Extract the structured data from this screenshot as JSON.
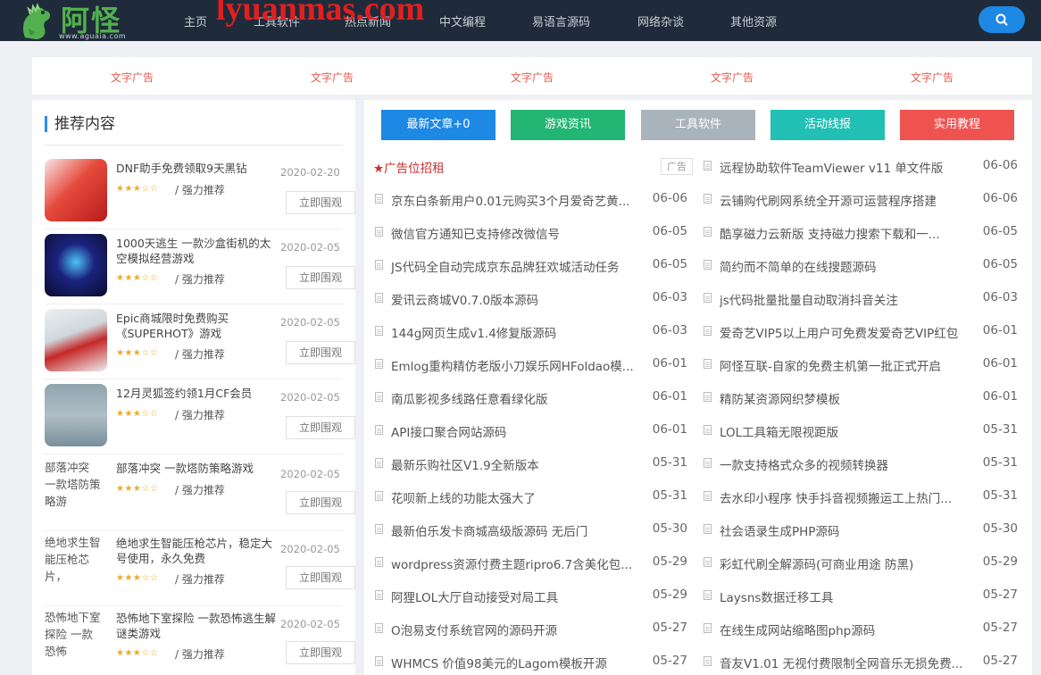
{
  "header": {
    "logo_text": "阿怪",
    "logo_url": "www.aguaia.com",
    "watermark": "lyuanmas.com",
    "nav": [
      "主页",
      "工具软件",
      "热点新闻",
      "中文编程",
      "易语言源码",
      "网络杂谈",
      "其他资源"
    ]
  },
  "ads": [
    "文字广告",
    "文字广告",
    "文字广告",
    "文字广告",
    "文字广告"
  ],
  "sidebar": {
    "title": "推荐内容",
    "items": [
      {
        "title": "DNF助手免费领取9天黑钻",
        "label": "/ 强力推荐",
        "date": "2020-02-20",
        "button": "立即围观",
        "stars": "★★★☆☆",
        "thumb_alt": ""
      },
      {
        "title": "1000天逃生 一款沙盒街机的太空模拟经营游戏",
        "label": "/ 强力推荐",
        "date": "2020-02-05",
        "button": "立即围观",
        "stars": "★★★☆☆",
        "thumb_alt": ""
      },
      {
        "title": "Epic商城限时免费购买《SUPERHOT》游戏",
        "label": "/ 强力推荐",
        "date": "2020-02-05",
        "button": "立即围观",
        "stars": "★★★☆☆",
        "thumb_alt": ""
      },
      {
        "title": "12月灵狐签约领1月CF会员",
        "label": "/ 强力推荐",
        "date": "2020-02-05",
        "button": "立即围观",
        "stars": "★★★☆☆",
        "thumb_alt": ""
      },
      {
        "title": "部落冲突 一款塔防策略游戏",
        "label": "/ 强力推荐",
        "date": "2020-02-05",
        "button": "立即围观",
        "stars": "★★★☆☆",
        "thumb_alt": "部落冲突 一款塔防策略游"
      },
      {
        "title": "绝地求生智能压枪芯片，稳定大号使用，永久免费",
        "label": "/ 强力推荐",
        "date": "2020-02-05",
        "button": "立即围观",
        "stars": "★★★☆☆",
        "thumb_alt": "绝地求生智能压枪芯片，"
      },
      {
        "title": "恐怖地下室探险 一款恐怖逃生解谜类游戏",
        "label": "/ 强力推荐",
        "date": "2020-02-05",
        "button": "立即围观",
        "stars": "★★★☆☆",
        "thumb_alt": "恐怖地下室探险 一款恐怖"
      }
    ]
  },
  "tabs": [
    {
      "label": "最新文章+0",
      "color": "#1e88e5"
    },
    {
      "label": "游戏资讯",
      "color": "#22b573"
    },
    {
      "label": "工具软件",
      "color": "#a9b3bb"
    },
    {
      "label": "活动线报",
      "color": "#21bfb4"
    },
    {
      "label": "实用教程",
      "color": "#ef5350"
    }
  ],
  "ad_row": {
    "title": "★广告位招租",
    "tag": "广告"
  },
  "articles_left": [
    {
      "title": "京东白条新用户0.01元购买3个月爱奇艺黄...",
      "date": "06-06"
    },
    {
      "title": "微信官方通知已支持修改微信号",
      "date": "06-05"
    },
    {
      "title": "JS代码全自动完成京东品牌狂欢城活动任务",
      "date": "06-05"
    },
    {
      "title": "爱讯云商城V0.7.0版本源码",
      "date": "06-03"
    },
    {
      "title": "144g网页生成v1.4修复版源码",
      "date": "06-03"
    },
    {
      "title": "Emlog重构精仿老版小刀娱乐网HFoldao模...",
      "date": "06-01"
    },
    {
      "title": "南瓜影视多线路任意看绿化版",
      "date": "06-01"
    },
    {
      "title": "API接口聚合网站源码",
      "date": "06-01"
    },
    {
      "title": "最新乐购社区V1.9全新版本",
      "date": "05-31"
    },
    {
      "title": "花呗新上线的功能太强大了",
      "date": "05-31"
    },
    {
      "title": "最新伯乐发卡商城高级版源码 无后门",
      "date": "05-30"
    },
    {
      "title": "wordpress资源付费主题ripro6.7含美化包...",
      "date": "05-29"
    },
    {
      "title": "阿狸LOL大厅自动接受对局工具",
      "date": "05-29"
    },
    {
      "title": "O泡易支付系统官网的源码开源",
      "date": "05-27"
    },
    {
      "title": "WHMCS 价值98美元的Lagom模板开源",
      "date": "05-27"
    }
  ],
  "articles_right": [
    {
      "title": "远程协助软件TeamViewer v11 单文件版",
      "date": "06-06"
    },
    {
      "title": "云铺购代刷网系统全开源可运营程序搭建",
      "date": "06-06"
    },
    {
      "title": "酷享磁力云新版 支持磁力搜索下载和一...",
      "date": "06-05"
    },
    {
      "title": "简约而不简单的在线搜题源码",
      "date": "06-05"
    },
    {
      "title": "js代码批量批量自动取消抖音关注",
      "date": "06-03"
    },
    {
      "title": "爱奇艺VIP5以上用户可免费发爱奇艺VIP红包",
      "date": "06-01"
    },
    {
      "title": "阿怪互联-自家的免费主机第一批正式开启",
      "date": "06-01"
    },
    {
      "title": "精防某资源网织梦模板",
      "date": "06-01"
    },
    {
      "title": "LOL工具箱无限视距版",
      "date": "05-31"
    },
    {
      "title": "一款支持格式众多的视频转换器",
      "date": "05-31"
    },
    {
      "title": "去水印小程序 快手抖音视频搬运工上热门...",
      "date": "05-31"
    },
    {
      "title": "社会语录生成PHP源码",
      "date": "05-30"
    },
    {
      "title": "彩虹代刷全解源码(可商业用途 防黑)",
      "date": "05-29"
    },
    {
      "title": "Laysns数据迁移工具",
      "date": "05-27"
    },
    {
      "title": "在线生成网站缩略图php源码",
      "date": "05-27"
    },
    {
      "title": "音友V1.01 无视付费限制全网音乐无损免费...",
      "date": "05-27"
    }
  ],
  "icons": {
    "search": "search-icon",
    "logo": "dinosaur-logo-icon",
    "article": "document-icon"
  }
}
